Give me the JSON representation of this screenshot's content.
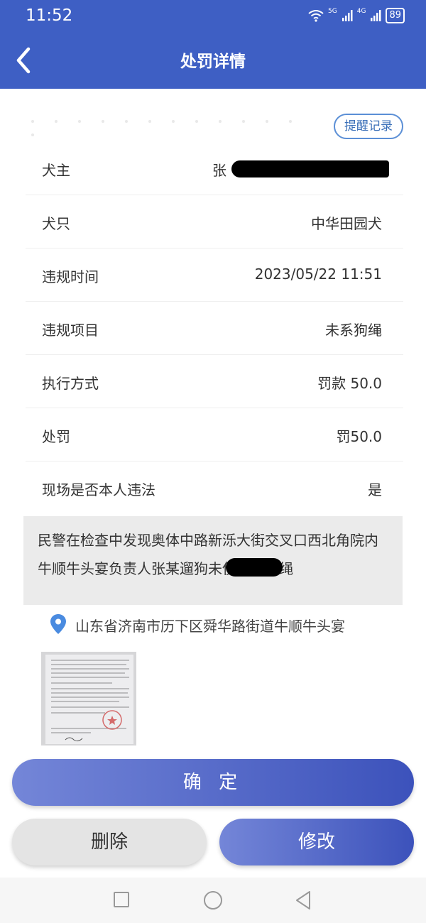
{
  "status_bar": {
    "time": "11:52",
    "network_a": "5G",
    "network_b": "4G",
    "battery": "89"
  },
  "nav": {
    "title": "处罚详情"
  },
  "remind_button": "提醒记录",
  "rows": [
    {
      "label": "犬主",
      "value": "张"
    },
    {
      "label": "犬只",
      "value": "中华田园犬"
    },
    {
      "label": "违规时间",
      "value": "2023/05/22 11:51"
    },
    {
      "label": "违规项目",
      "value": "未系狗绳"
    },
    {
      "label": "执行方式",
      "value": "罚款 50.0"
    },
    {
      "label": "处罚",
      "value": "罚50.0"
    },
    {
      "label": "现场是否本人违法",
      "value": "是"
    }
  ],
  "description": "民警在检查中发现奥体中路新泺大街交叉口西北角院内牛顺牛头宴负责人张某遛狗未使用束犬绳",
  "location": "山东省济南市历下区舜华路街道牛顺牛头宴",
  "buttons": {
    "confirm": "确 定",
    "delete": "删除",
    "edit": "修改"
  },
  "icons": {
    "back": "chevron-left-icon",
    "pin": "location-pin-icon",
    "wifi": "wifi-icon",
    "signal": "signal-icon",
    "battery": "battery-icon"
  },
  "colors": {
    "header": "#3e5fc4",
    "accent": "#5b8fd6",
    "button_gradient_start": "#7486d8",
    "button_gradient_end": "#3c52bb"
  }
}
